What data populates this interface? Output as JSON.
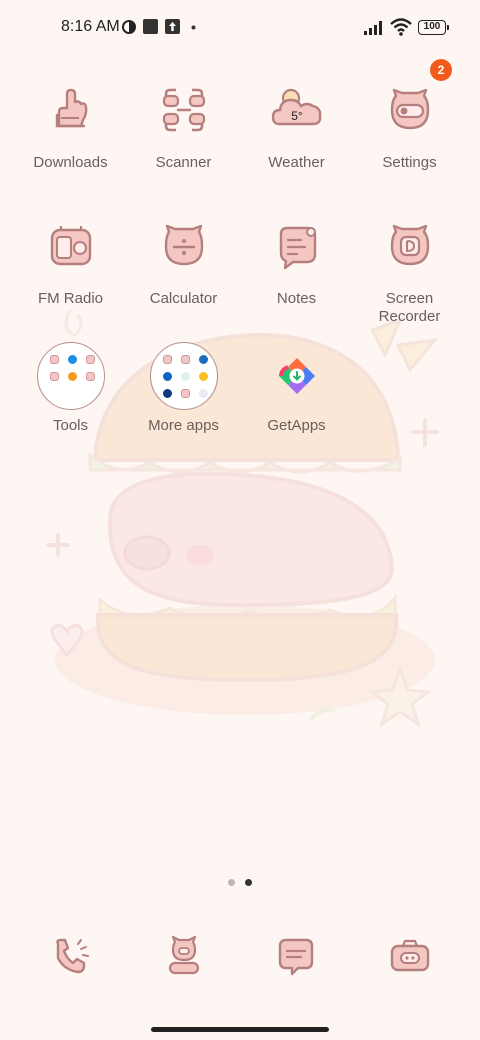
{
  "status_bar": {
    "time": "8:16 AM",
    "battery": "100"
  },
  "apps": [
    {
      "label": "Downloads",
      "icon": "downloads-icon"
    },
    {
      "label": "Scanner",
      "icon": "scanner-icon"
    },
    {
      "label": "Weather",
      "icon": "weather-icon",
      "temp": "5°"
    },
    {
      "label": "Settings",
      "icon": "settings-icon",
      "badge": "2"
    },
    {
      "label": "FM Radio",
      "icon": "fm-radio-icon"
    },
    {
      "label": "Calculator",
      "icon": "calculator-icon"
    },
    {
      "label": "Notes",
      "icon": "notes-icon"
    },
    {
      "label": "Screen\nRecorder",
      "icon": "screen-recorder-icon"
    },
    {
      "label": "Tools",
      "icon": "tools-folder-icon"
    },
    {
      "label": "More apps",
      "icon": "more-apps-folder-icon"
    },
    {
      "label": "GetApps",
      "icon": "getapps-icon"
    }
  ],
  "page_indicator": {
    "total": 2,
    "current": 2
  },
  "dock": [
    "phone-icon",
    "contacts-icon",
    "messages-icon",
    "camera-icon"
  ],
  "colors": {
    "accent_line": "#b47f7d",
    "fill_pink": "#f4c7c3",
    "badge": "#f25a1c"
  }
}
